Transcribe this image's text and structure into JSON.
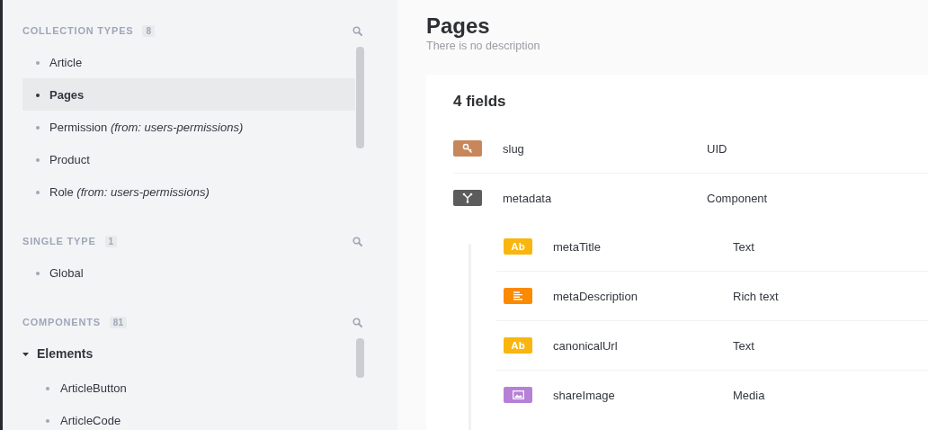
{
  "sidebar": {
    "sections": [
      {
        "kind": "list",
        "title": "COLLECTION TYPES",
        "count": "8",
        "items": [
          {
            "label": "Article",
            "selected": false
          },
          {
            "label": "Pages",
            "selected": true
          },
          {
            "label": "Permission *(from: users-permissions)*",
            "selected": false
          },
          {
            "label": "Product",
            "selected": false
          },
          {
            "label": "Role *(from: users-permissions)*",
            "selected": false
          }
        ]
      },
      {
        "kind": "list",
        "title": "SINGLE TYPE",
        "count": "1",
        "items": [
          {
            "label": "Global",
            "selected": false
          }
        ]
      },
      {
        "kind": "groups",
        "title": "COMPONENTS",
        "count": "81",
        "groups": [
          {
            "label": "Elements",
            "expanded": true,
            "children": [
              {
                "label": "ArticleButton",
                "selected": false
              },
              {
                "label": "ArticleCode",
                "selected": false
              }
            ]
          }
        ]
      }
    ]
  },
  "page": {
    "title": "Pages",
    "description": "There is no description"
  },
  "card": {
    "heading": "4 fields",
    "fields": [
      {
        "name": "slug",
        "type": "UID",
        "kind": "uid",
        "color": "#c8875a"
      },
      {
        "name": "metadata",
        "type": "Component",
        "kind": "component",
        "color": "#5c5c5c",
        "children": [
          {
            "name": "metaTitle",
            "type": "Text",
            "kind": "text",
            "badge": "Ab",
            "color": "#fab60e"
          },
          {
            "name": "metaDescription",
            "type": "Rich text",
            "kind": "richtext",
            "color": "#fb8a00"
          },
          {
            "name": "canonicalUrl",
            "type": "Text",
            "kind": "text",
            "badge": "Ab",
            "color": "#fab60e"
          },
          {
            "name": "shareImage",
            "type": "Media",
            "kind": "media",
            "color": "#b680d7"
          }
        ]
      }
    ]
  }
}
